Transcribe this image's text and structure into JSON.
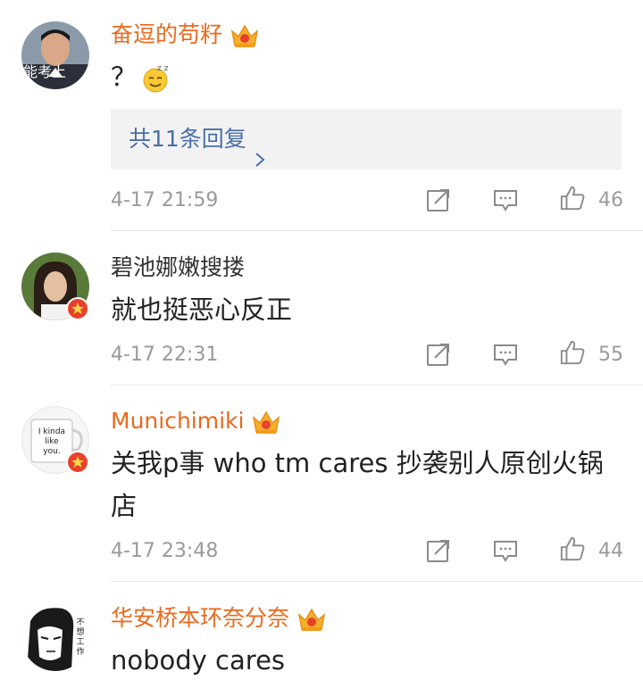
{
  "comments": [
    {
      "username": "奋逗的苟籽",
      "avatar_text": "能考上",
      "text": "？",
      "emoji": "sleepy-smile-emoji",
      "replies_label": "共11条回复",
      "time": "4-17 21:59",
      "likes": "46",
      "vip": true
    },
    {
      "username": "碧池娜嫩搜搂",
      "text": "就也挺恶心反正",
      "time": "4-17 22:31",
      "likes": "55",
      "vip": false
    },
    {
      "username": "Munichimiki",
      "avatar_text": "I kinda like you.",
      "text": "关我p事 who tm cares 抄袭别人原创火锅店",
      "time": "4-17 23:48",
      "likes": "44",
      "vip": true
    },
    {
      "username": "华安桥本环奈分奈",
      "avatar_text": "不想工作",
      "text": "nobody cares",
      "vip": true
    }
  ],
  "colors": {
    "vip_name": "#e86a1d",
    "reply_link": "#4a6fa8",
    "meta_gray": "#9a9a9a",
    "verified_badge": "#e8412b"
  },
  "icons": [
    "share-icon",
    "comment-icon",
    "like-icon",
    "crown-icon",
    "chevron-right-icon"
  ]
}
